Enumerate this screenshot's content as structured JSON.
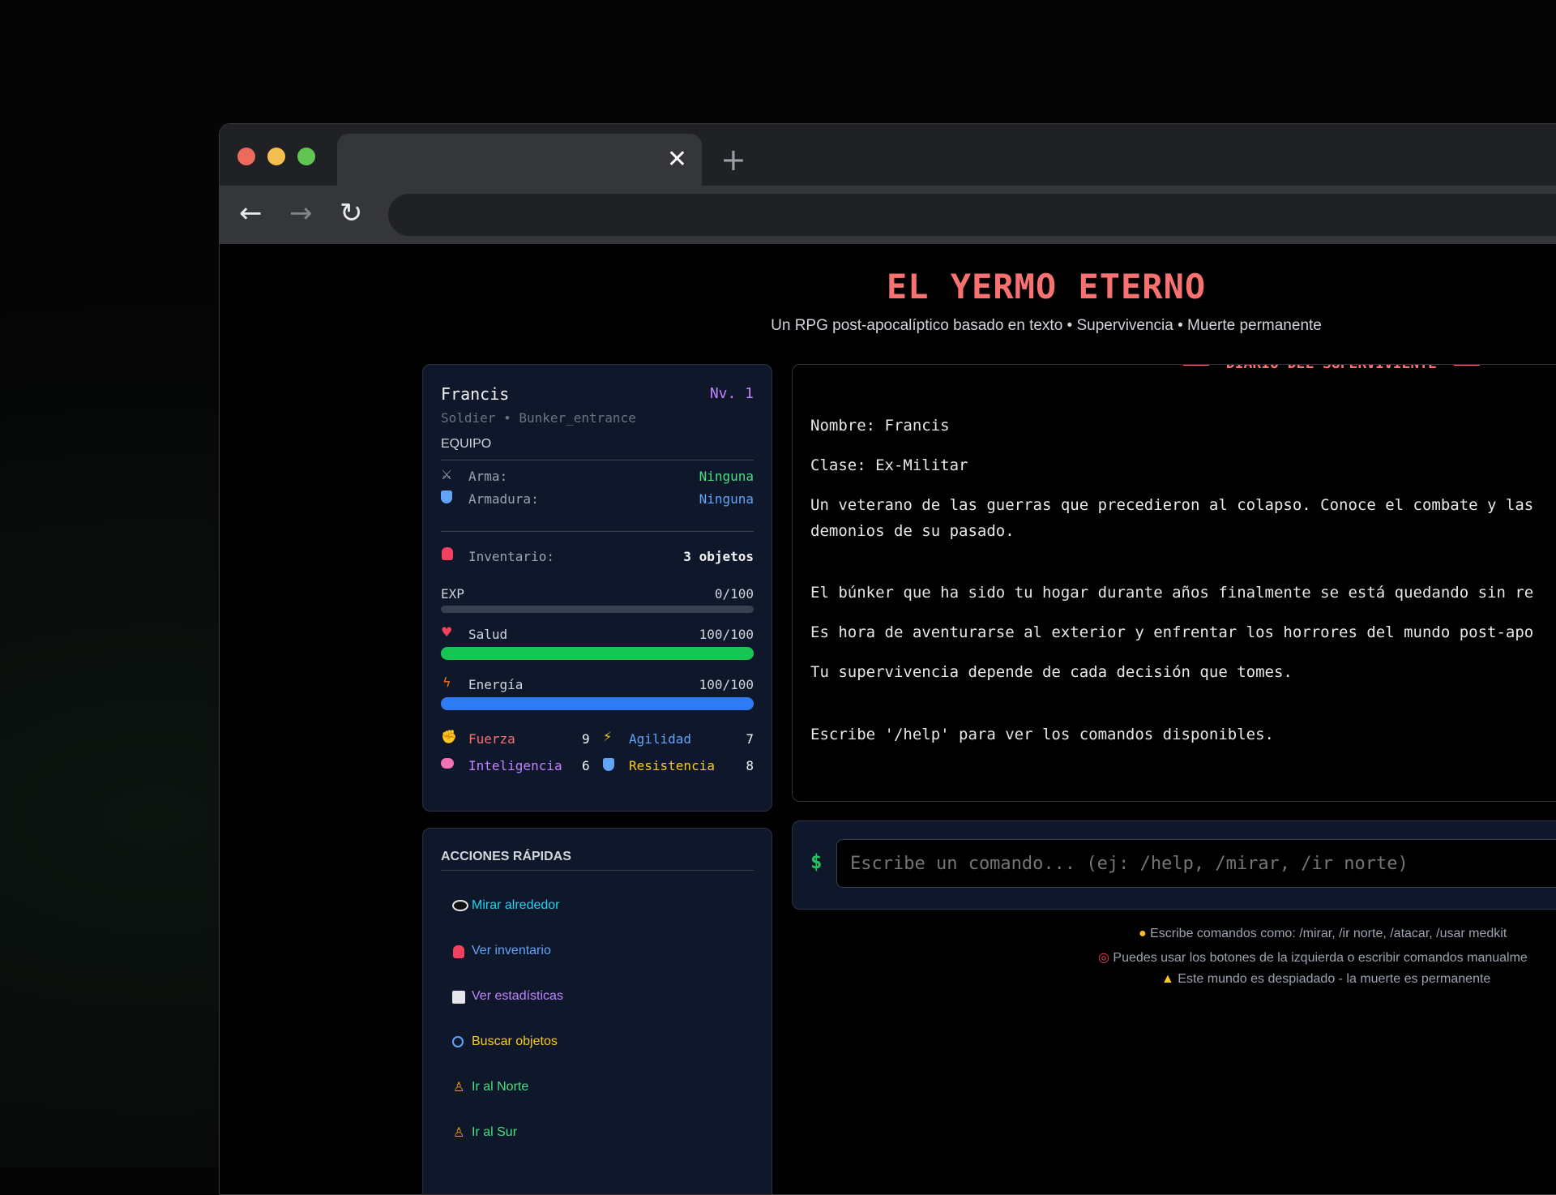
{
  "browser": {
    "tab_close": "✕",
    "new_tab": "+",
    "back": "←",
    "forward": "→",
    "reload": "↻"
  },
  "header": {
    "title": "EL YERMO ETERNO",
    "subtitle": "Un RPG post-apocalíptico basado en texto • Supervivencia • Muerte permanente"
  },
  "character": {
    "name": "Francis",
    "level": "Nv. 1",
    "class_location": "Soldier • Bunker_entrance",
    "equipment_title": "EQUIPO",
    "weapon_label": "Arma:",
    "weapon_value": "Ninguna",
    "armor_label": "Armadura:",
    "armor_value": "Ninguna",
    "inventory_label": "Inventario:",
    "inventory_value": "3 objetos",
    "exp_label": "EXP",
    "exp_value": "0/100",
    "exp_fraction": 0,
    "health_label": "Salud",
    "health_value": "100/100",
    "health_fraction": 1,
    "energy_label": "Energía",
    "energy_value": "100/100",
    "energy_fraction": 1,
    "stats": {
      "strength_label": "Fuerza",
      "strength_value": "9",
      "agility_label": "Agilidad",
      "agility_value": "7",
      "intelligence_label": "Inteligencia",
      "intelligence_value": "6",
      "resistance_label": "Resistencia",
      "resistance_value": "8"
    }
  },
  "quick_actions": {
    "title": "ACCIONES RÁPIDAS",
    "items": [
      {
        "label": "Mirar alrededor",
        "icon": "eye-icon",
        "color": "#22d3ee"
      },
      {
        "label": "Ver inventario",
        "icon": "backpack-icon",
        "color": "#60a5fa"
      },
      {
        "label": "Ver estadísticas",
        "icon": "bar-chart-icon",
        "color": "#c084fc"
      },
      {
        "label": "Buscar objetos",
        "icon": "magnifier-icon",
        "color": "#facc15"
      },
      {
        "label": "Ir al Norte",
        "icon": "walking-icon",
        "color": "#4ade80"
      },
      {
        "label": "Ir al Sur",
        "icon": "walking-icon",
        "color": "#4ade80"
      }
    ]
  },
  "journal": {
    "heading": "DIARIO DEL SUPERVIVIENTE",
    "lines": [
      "Nombre: Francis",
      "Clase: Ex-Militar",
      "Un veterano de las guerras que precedieron al colapso. Conoce el combate y las",
      "demonios de su pasado.",
      "El búnker que ha sido tu hogar durante años finalmente se está quedando sin re",
      "Es hora de aventurarse al exterior y enfrentar los horrores del mundo post-apo",
      "Tu supervivencia depende de cada decisión que tomes.",
      "Escribe '/help' para ver los comandos disponibles."
    ]
  },
  "command": {
    "prompt": "$",
    "placeholder": "Escribe un comando... (ej: /help, /mirar, /ir norte)"
  },
  "tips": [
    "Escribe comandos como: /mirar, /ir norte, /atacar, /usar medkit",
    "Puedes usar los botones de la izquierda o escribir comandos manualme",
    "Este mundo es despiadado - la muerte es permanente"
  ],
  "colors": {
    "title": "#f87171",
    "health": "#16c653",
    "energy": "#2f7bf6",
    "level": "#c084fc",
    "weapon": "#4ade80",
    "armor": "#60a5fa",
    "prompt": "#22c55e"
  }
}
